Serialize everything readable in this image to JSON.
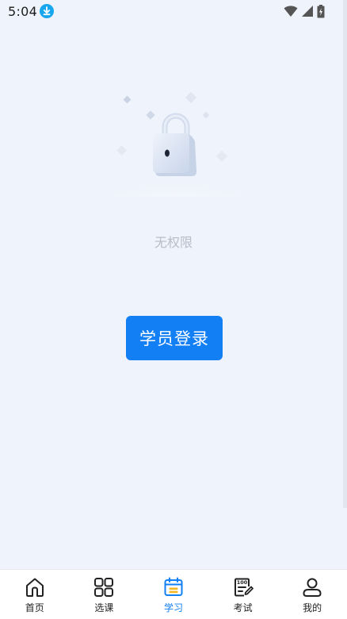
{
  "status_bar": {
    "time": "5:04"
  },
  "content": {
    "empty_text": "无权限",
    "login_button_label": "学员登录"
  },
  "bottom_nav": {
    "items": [
      {
        "label": "首页",
        "icon": "home-icon"
      },
      {
        "label": "选课",
        "icon": "grid-icon"
      },
      {
        "label": "学习",
        "icon": "calendar-icon",
        "active": true
      },
      {
        "label": "考试",
        "icon": "exam-icon"
      },
      {
        "label": "我的",
        "icon": "user-icon"
      }
    ]
  },
  "colors": {
    "accent": "#127ff5",
    "background": "#eff3fb"
  }
}
